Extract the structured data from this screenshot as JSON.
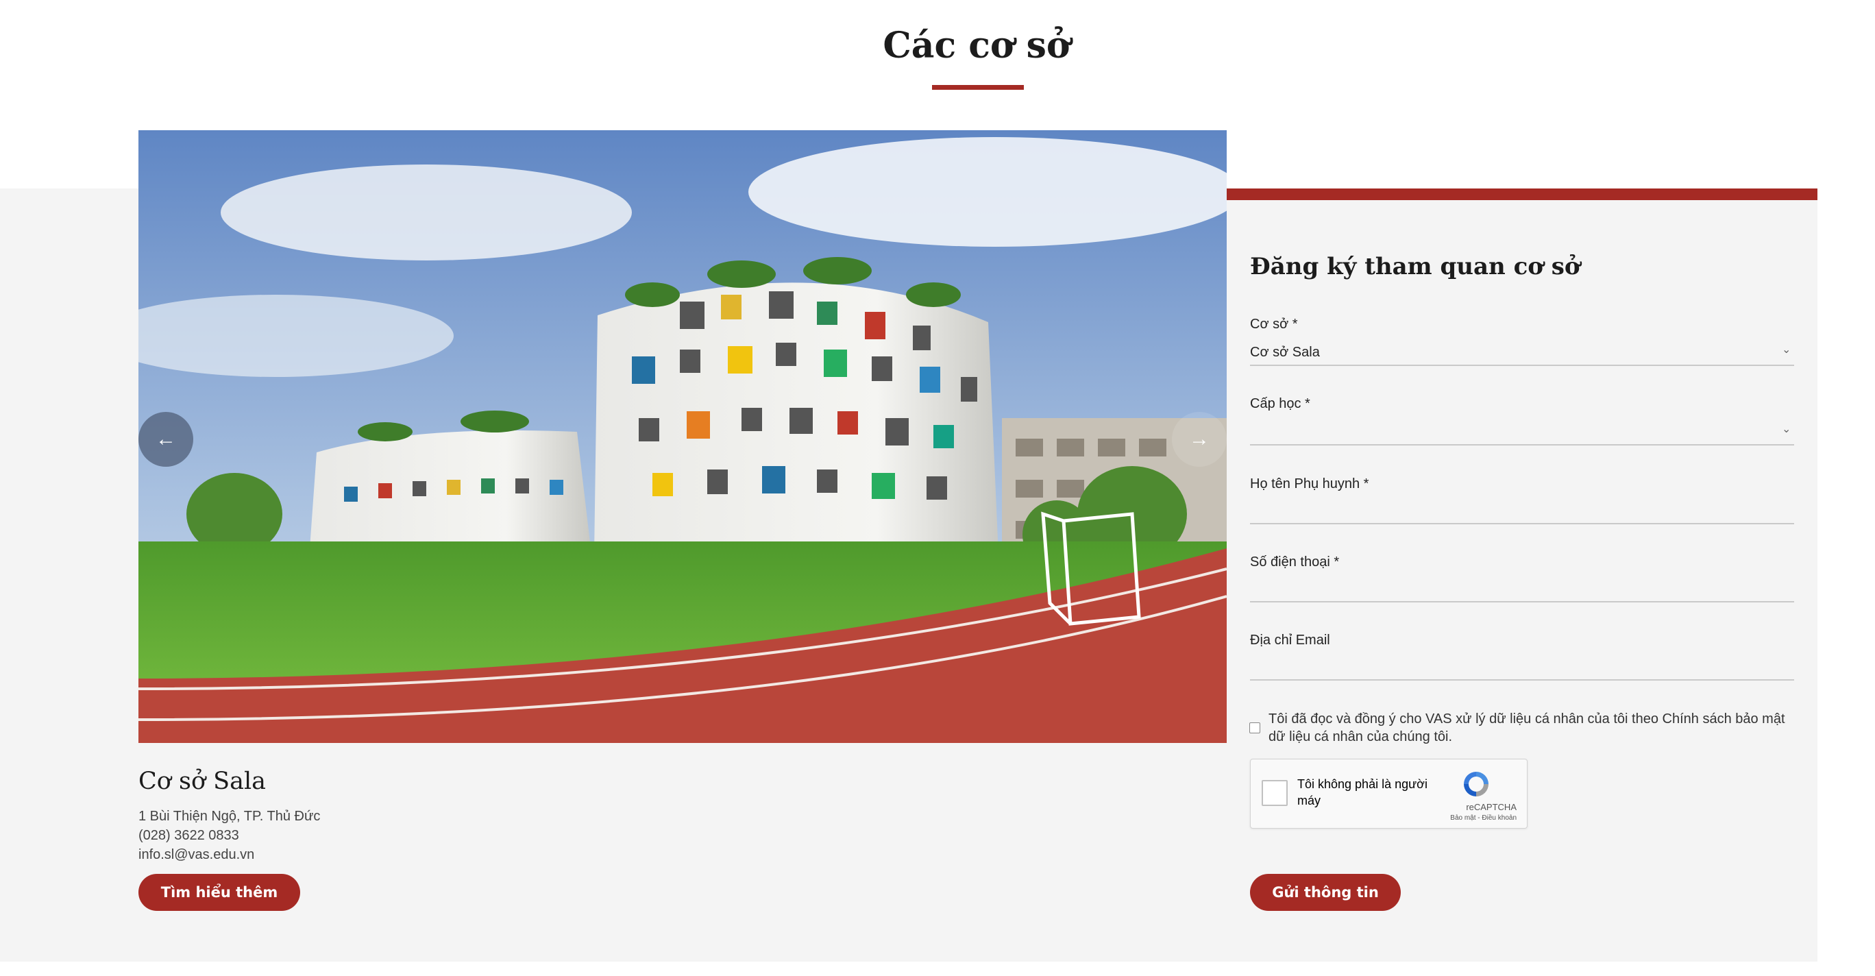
{
  "page": {
    "title": "Các cơ sở"
  },
  "carousel": {
    "prev_icon": "arrow-left-icon",
    "next_icon": "arrow-right-icon",
    "prev_glyph": "←",
    "next_glyph": "→"
  },
  "campus": {
    "name": "Cơ sở Sala",
    "address": "1 Bùi Thiện Ngộ, TP. Thủ Đức",
    "phone": "(028) 3622 0833",
    "email": "info.sl@vas.edu.vn",
    "learn_more_label": "Tìm hiểu thêm"
  },
  "form": {
    "title": "Đăng ký tham quan cơ sở",
    "campus_label": "Cơ sở *",
    "campus_value": "Cơ sở Sala",
    "level_label": "Cấp học *",
    "level_value": "",
    "parent_name_label": "Họ tên Phụ huynh *",
    "phone_label": "Số điện thoại *",
    "email_label": "Địa chỉ Email",
    "chevron_glyph": "⌄",
    "consent_text": "Tôi đã đọc và đồng ý cho VAS xử lý dữ liệu cá nhân của tôi theo Chính sách bảo mật dữ liệu cá nhân của chúng tôi.",
    "consent_checked": false,
    "captcha_text": "Tôi không phải là người máy",
    "captcha_brand": "reCAPTCHA",
    "captcha_links": "Bảo mật - Điều khoản",
    "submit_label": "Gửi thông tin"
  },
  "colors": {
    "accent": "#a52a24",
    "band_background": "#f4f4f4",
    "field_line": "#c9c9c9"
  }
}
